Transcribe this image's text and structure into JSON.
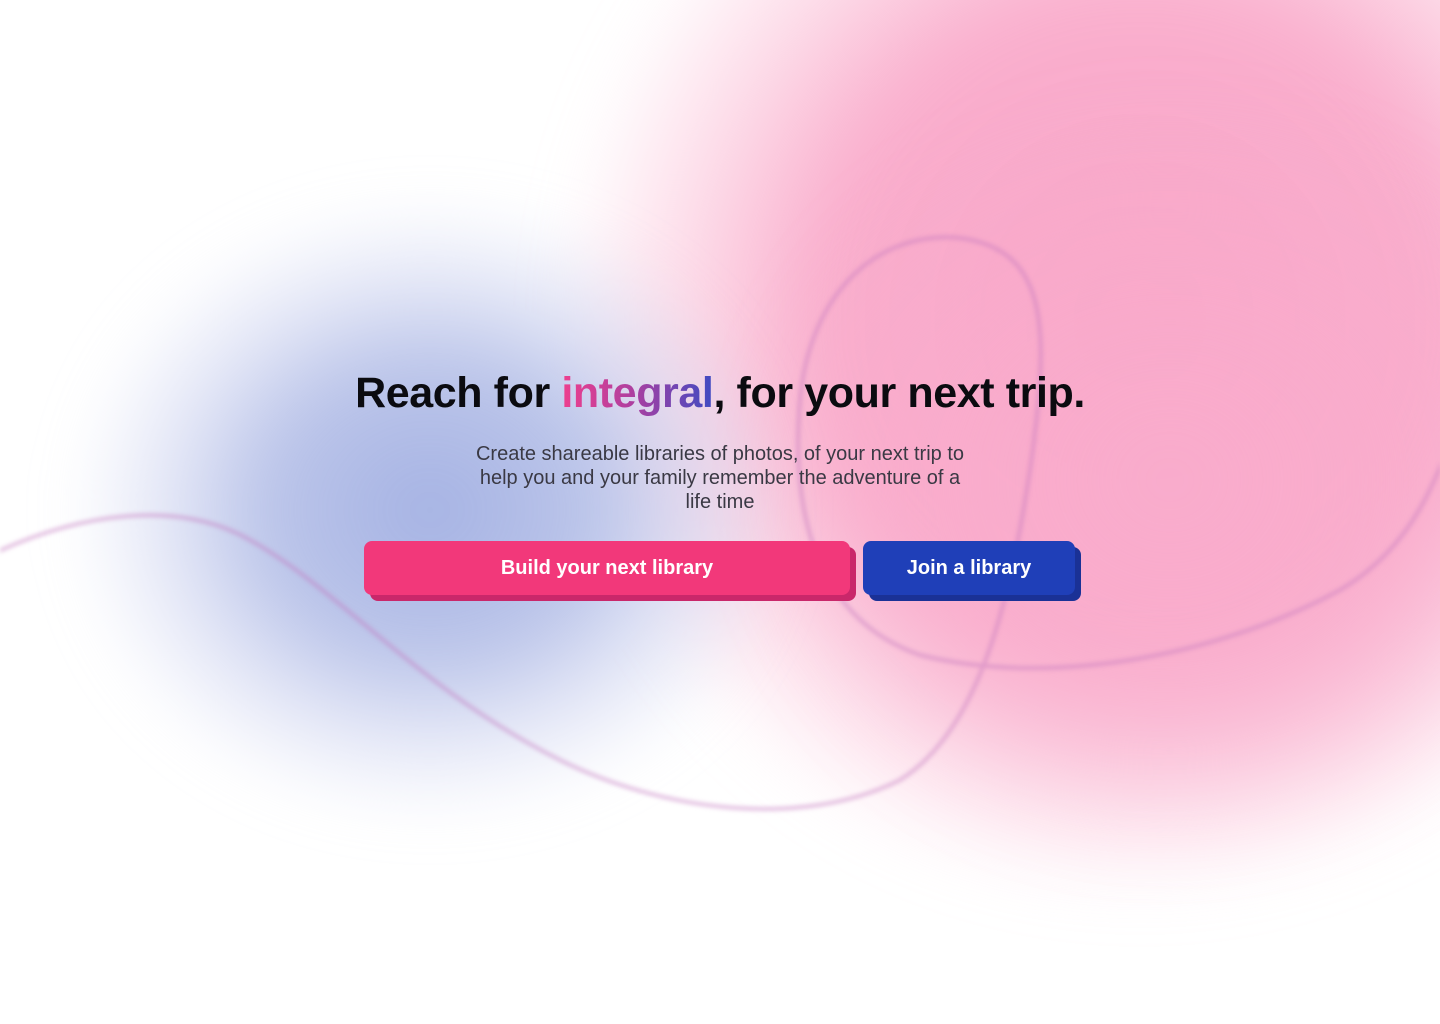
{
  "hero": {
    "headline_prefix": "Reach for ",
    "headline_accent": "integral",
    "headline_suffix": ", for your next trip.",
    "subtitle": "Create shareable libraries of photos, of your next trip to help you and your family remember the adventure of a life time"
  },
  "actions": {
    "primary_label": "Build your next library",
    "secondary_label": "Join a library"
  },
  "colors": {
    "primary_button": "#f2387a",
    "primary_button_shadow": "#c9276a",
    "secondary_button": "#1f3fb8",
    "secondary_button_shadow": "#1a3196",
    "accent_gradient_start": "#ee3f8e",
    "accent_gradient_end": "#3f4bc2",
    "background_pink": "#f9a8c9",
    "background_blue": "#a0aee2"
  }
}
